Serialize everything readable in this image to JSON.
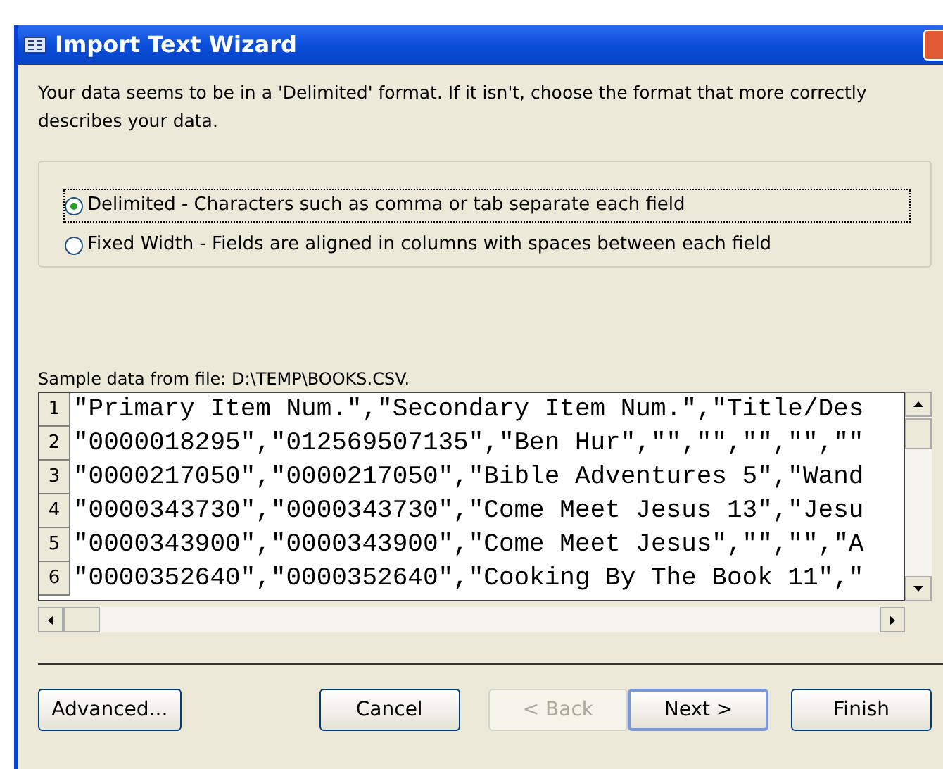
{
  "window": {
    "title": "Import Text Wizard"
  },
  "intro": "Your data seems to be in a 'Delimited' format. If it isn't, choose the format that more correctly describes your data.",
  "formats": [
    {
      "label": "Delimited - Characters such as comma or tab separate each field",
      "selected": true
    },
    {
      "label": "Fixed Width - Fields are aligned in columns with spaces between each field",
      "selected": false
    }
  ],
  "sample": {
    "label": "Sample data from file: D:\\TEMP\\BOOKS.CSV.",
    "rows": [
      {
        "number": "1",
        "text": "\"Primary Item Num.\",\"Secondary Item Num.\",\"Title/Des"
      },
      {
        "number": "2",
        "text": "\"0000018295\",\"012569507135\",\"Ben Hur\",\"\",\"\",\"\",\"\",\"\""
      },
      {
        "number": "3",
        "text": "\"0000217050\",\"0000217050\",\"Bible Adventures 5\",\"Wand"
      },
      {
        "number": "4",
        "text": "\"0000343730\",\"0000343730\",\"Come Meet Jesus 13\",\"Jesu"
      },
      {
        "number": "5",
        "text": "\"0000343900\",\"0000343900\",\"Come Meet Jesus\",\"\",\"\",\"A"
      },
      {
        "number": "6",
        "text": "\"0000352640\",\"0000352640\",\"Cooking By The Book 11\",\""
      }
    ]
  },
  "buttons": [
    {
      "label": "Advanced...",
      "disabled": false,
      "default": false
    },
    {
      "label": "Cancel",
      "disabled": false,
      "default": false
    },
    {
      "label": "< Back",
      "disabled": true,
      "default": false
    },
    {
      "label": "Next >",
      "disabled": false,
      "default": true
    },
    {
      "label": "Finish",
      "disabled": false,
      "default": false
    }
  ]
}
